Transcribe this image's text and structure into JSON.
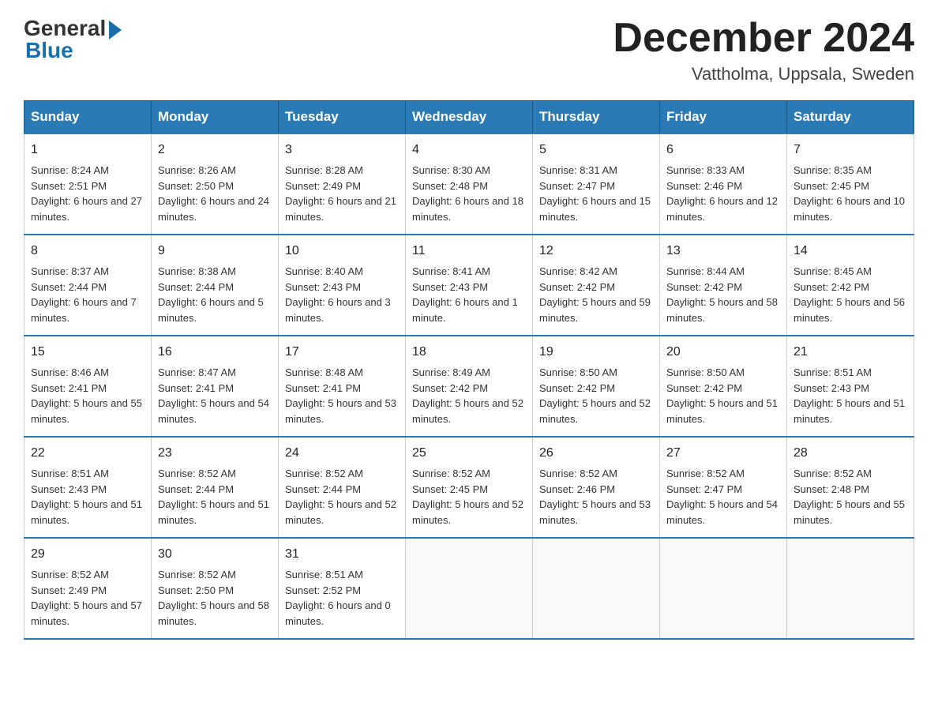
{
  "header": {
    "logo_general": "General",
    "logo_blue": "Blue",
    "month_title": "December 2024",
    "location": "Vattholma, Uppsala, Sweden"
  },
  "days_of_week": [
    "Sunday",
    "Monday",
    "Tuesday",
    "Wednesday",
    "Thursday",
    "Friday",
    "Saturday"
  ],
  "weeks": [
    [
      {
        "day": "1",
        "sunrise": "8:24 AM",
        "sunset": "2:51 PM",
        "daylight": "6 hours and 27 minutes."
      },
      {
        "day": "2",
        "sunrise": "8:26 AM",
        "sunset": "2:50 PM",
        "daylight": "6 hours and 24 minutes."
      },
      {
        "day": "3",
        "sunrise": "8:28 AM",
        "sunset": "2:49 PM",
        "daylight": "6 hours and 21 minutes."
      },
      {
        "day": "4",
        "sunrise": "8:30 AM",
        "sunset": "2:48 PM",
        "daylight": "6 hours and 18 minutes."
      },
      {
        "day": "5",
        "sunrise": "8:31 AM",
        "sunset": "2:47 PM",
        "daylight": "6 hours and 15 minutes."
      },
      {
        "day": "6",
        "sunrise": "8:33 AM",
        "sunset": "2:46 PM",
        "daylight": "6 hours and 12 minutes."
      },
      {
        "day": "7",
        "sunrise": "8:35 AM",
        "sunset": "2:45 PM",
        "daylight": "6 hours and 10 minutes."
      }
    ],
    [
      {
        "day": "8",
        "sunrise": "8:37 AM",
        "sunset": "2:44 PM",
        "daylight": "6 hours and 7 minutes."
      },
      {
        "day": "9",
        "sunrise": "8:38 AM",
        "sunset": "2:44 PM",
        "daylight": "6 hours and 5 minutes."
      },
      {
        "day": "10",
        "sunrise": "8:40 AM",
        "sunset": "2:43 PM",
        "daylight": "6 hours and 3 minutes."
      },
      {
        "day": "11",
        "sunrise": "8:41 AM",
        "sunset": "2:43 PM",
        "daylight": "6 hours and 1 minute."
      },
      {
        "day": "12",
        "sunrise": "8:42 AM",
        "sunset": "2:42 PM",
        "daylight": "5 hours and 59 minutes."
      },
      {
        "day": "13",
        "sunrise": "8:44 AM",
        "sunset": "2:42 PM",
        "daylight": "5 hours and 58 minutes."
      },
      {
        "day": "14",
        "sunrise": "8:45 AM",
        "sunset": "2:42 PM",
        "daylight": "5 hours and 56 minutes."
      }
    ],
    [
      {
        "day": "15",
        "sunrise": "8:46 AM",
        "sunset": "2:41 PM",
        "daylight": "5 hours and 55 minutes."
      },
      {
        "day": "16",
        "sunrise": "8:47 AM",
        "sunset": "2:41 PM",
        "daylight": "5 hours and 54 minutes."
      },
      {
        "day": "17",
        "sunrise": "8:48 AM",
        "sunset": "2:41 PM",
        "daylight": "5 hours and 53 minutes."
      },
      {
        "day": "18",
        "sunrise": "8:49 AM",
        "sunset": "2:42 PM",
        "daylight": "5 hours and 52 minutes."
      },
      {
        "day": "19",
        "sunrise": "8:50 AM",
        "sunset": "2:42 PM",
        "daylight": "5 hours and 52 minutes."
      },
      {
        "day": "20",
        "sunrise": "8:50 AM",
        "sunset": "2:42 PM",
        "daylight": "5 hours and 51 minutes."
      },
      {
        "day": "21",
        "sunrise": "8:51 AM",
        "sunset": "2:43 PM",
        "daylight": "5 hours and 51 minutes."
      }
    ],
    [
      {
        "day": "22",
        "sunrise": "8:51 AM",
        "sunset": "2:43 PM",
        "daylight": "5 hours and 51 minutes."
      },
      {
        "day": "23",
        "sunrise": "8:52 AM",
        "sunset": "2:44 PM",
        "daylight": "5 hours and 51 minutes."
      },
      {
        "day": "24",
        "sunrise": "8:52 AM",
        "sunset": "2:44 PM",
        "daylight": "5 hours and 52 minutes."
      },
      {
        "day": "25",
        "sunrise": "8:52 AM",
        "sunset": "2:45 PM",
        "daylight": "5 hours and 52 minutes."
      },
      {
        "day": "26",
        "sunrise": "8:52 AM",
        "sunset": "2:46 PM",
        "daylight": "5 hours and 53 minutes."
      },
      {
        "day": "27",
        "sunrise": "8:52 AM",
        "sunset": "2:47 PM",
        "daylight": "5 hours and 54 minutes."
      },
      {
        "day": "28",
        "sunrise": "8:52 AM",
        "sunset": "2:48 PM",
        "daylight": "5 hours and 55 minutes."
      }
    ],
    [
      {
        "day": "29",
        "sunrise": "8:52 AM",
        "sunset": "2:49 PM",
        "daylight": "5 hours and 57 minutes."
      },
      {
        "day": "30",
        "sunrise": "8:52 AM",
        "sunset": "2:50 PM",
        "daylight": "5 hours and 58 minutes."
      },
      {
        "day": "31",
        "sunrise": "8:51 AM",
        "sunset": "2:52 PM",
        "daylight": "6 hours and 0 minutes."
      },
      null,
      null,
      null,
      null
    ]
  ]
}
